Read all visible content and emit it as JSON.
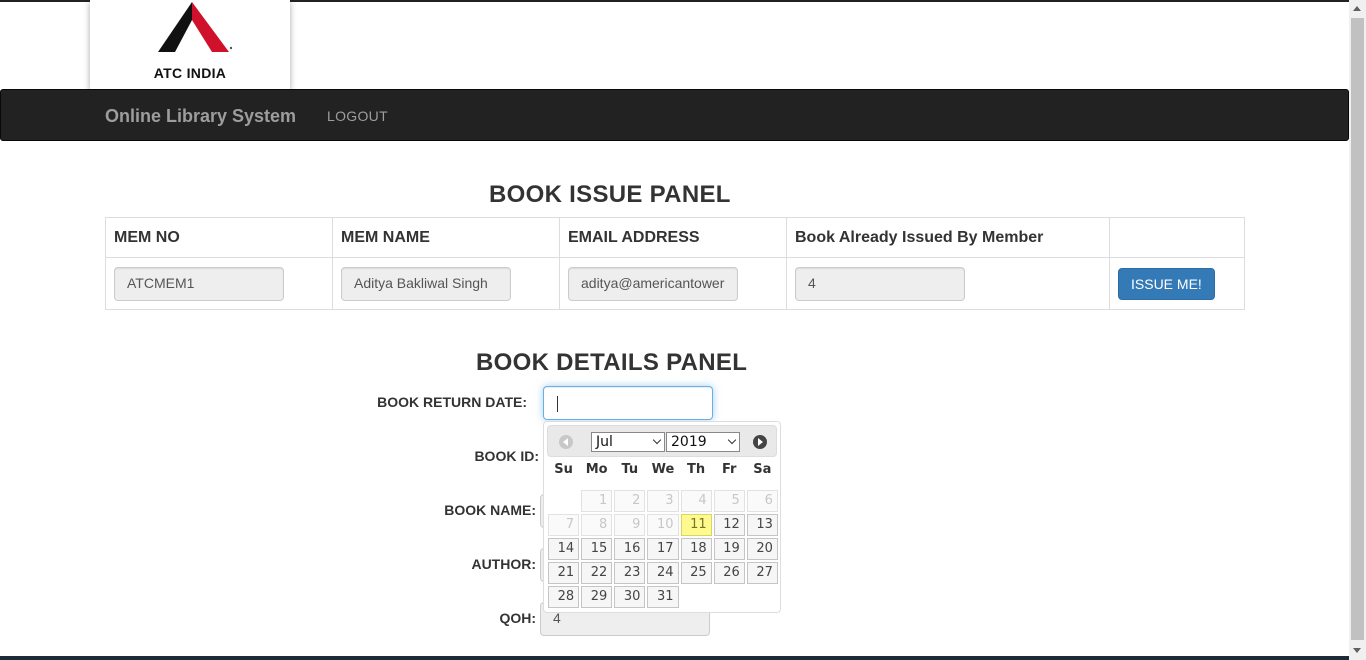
{
  "logo": {
    "text": "ATC INDIA"
  },
  "navbar": {
    "brand": "Online Library System",
    "logout": "LOGOUT"
  },
  "issue_panel": {
    "title": "BOOK ISSUE PANEL",
    "headers": [
      "MEM NO",
      "MEM NAME",
      "EMAIL ADDRESS",
      "Book Already Issued By Member",
      ""
    ],
    "mem_no": "ATCMEM1",
    "mem_name": "Aditya Bakliwal Singh",
    "email": "aditya@americantower",
    "books_issued": "4",
    "issue_button": "ISSUE ME!"
  },
  "details_panel": {
    "title": "BOOK DETAILS PANEL",
    "return_date_label": "BOOK RETURN DATE:",
    "return_date_value": "",
    "book_id_label": "BOOK ID:",
    "book_name_label": "BOOK NAME:",
    "author_label": "AUTHOR:",
    "qoh_label": "QOH:",
    "qoh_value": "4"
  },
  "datepicker": {
    "month": "Jul",
    "year": "2019",
    "weekdays": [
      "Su",
      "Mo",
      "Tu",
      "We",
      "Th",
      "Fr",
      "Sa"
    ],
    "today": "11",
    "weeks": [
      [
        "",
        "1",
        "2",
        "3",
        "4",
        "5",
        "6"
      ],
      [
        "7",
        "8",
        "9",
        "10",
        "11",
        "12",
        "13"
      ],
      [
        "14",
        "15",
        "16",
        "17",
        "18",
        "19",
        "20"
      ],
      [
        "21",
        "22",
        "23",
        "24",
        "25",
        "26",
        "27"
      ],
      [
        "28",
        "29",
        "30",
        "31",
        "",
        "",
        ""
      ]
    ],
    "disabled": [
      "1",
      "2",
      "3",
      "4",
      "5",
      "6",
      "7",
      "8",
      "9",
      "10"
    ]
  },
  "colors": {
    "navbar": "#222222",
    "primary": "#337ab7",
    "today": "#fffa90",
    "logo_red": "#d0112b"
  }
}
